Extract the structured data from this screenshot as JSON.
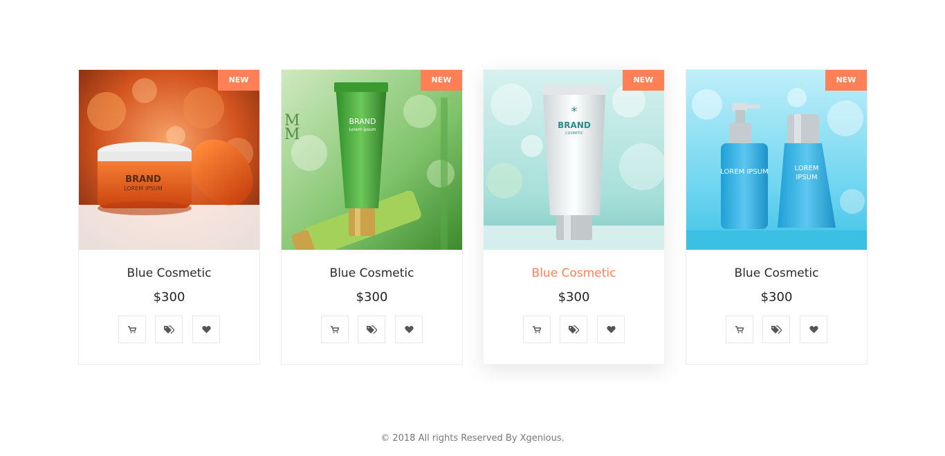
{
  "products": [
    {
      "badge": "NEW",
      "title": "Blue Cosmetic",
      "price": "$300",
      "image": "orange cream jar",
      "image_brand": "BRAND",
      "image_sub": "LOREM IPSUM"
    },
    {
      "badge": "NEW",
      "title": "Blue Cosmetic",
      "price": "$300",
      "image": "green cosmetic tubes",
      "image_brand": "BRAND",
      "image_sub": "Lorem ipsum"
    },
    {
      "badge": "NEW",
      "title": "Blue Cosmetic",
      "price": "$300",
      "image": "white cosmetic tube",
      "image_brand": "BRAND",
      "image_sub": "COSMETIC"
    },
    {
      "badge": "NEW",
      "title": "Blue Cosmetic",
      "price": "$300",
      "image": "blue cosmetic bottles",
      "image_brand": "LOREM IPSUM",
      "image_sub": ""
    }
  ],
  "actions": {
    "cart_icon": "cart-icon",
    "tag_icon": "tags-icon",
    "heart_icon": "heart-icon"
  },
  "colors": {
    "accent": "#ff7f56",
    "text": "#2a2a2a",
    "border": "#ececec"
  },
  "footer": {
    "text": "© 2018 All rights Reserved By Xgenious."
  }
}
